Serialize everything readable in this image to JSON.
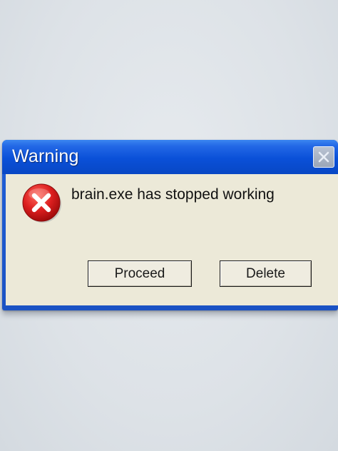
{
  "window": {
    "title": "Warning",
    "close_icon": "close-icon"
  },
  "dialog": {
    "icon": "error-icon",
    "message": "brain.exe has stopped working"
  },
  "buttons": {
    "proceed_label": "Proceed",
    "delete_label": "Delete"
  },
  "colors": {
    "titlebar": "#0a50d8",
    "dialog_body": "#ece9d8",
    "error_red": "#d61a1a"
  }
}
